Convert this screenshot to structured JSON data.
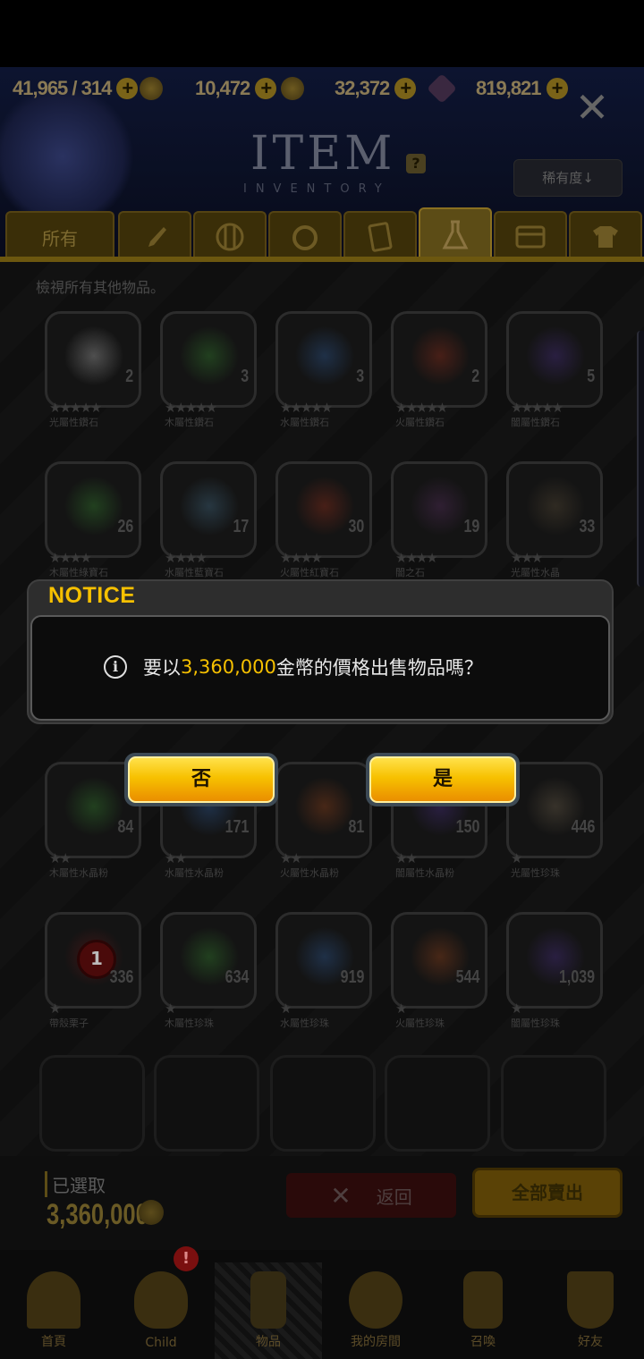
{
  "currencies": [
    {
      "value": "41,965 / 314",
      "icon": "stamina-icon"
    },
    {
      "value": "10,472",
      "icon": "gold-coin-icon"
    },
    {
      "value": "32,372",
      "icon": "coin-stack-icon"
    },
    {
      "value": "819,821",
      "icon": "gem-icon"
    }
  ],
  "header": {
    "title": "ITEM",
    "subtitle": "INVENTORY",
    "help": "?",
    "sort_label": "稀有度↓",
    "close": "✕"
  },
  "tabs": [
    {
      "label": "所有",
      "icon": ""
    },
    {
      "label": "",
      "icon": "sword-icon"
    },
    {
      "label": "",
      "icon": "shield-icon"
    },
    {
      "label": "",
      "icon": "ring-icon"
    },
    {
      "label": "",
      "icon": "card-icon"
    },
    {
      "label": "",
      "icon": "potion-flask-icon"
    },
    {
      "label": "",
      "icon": "chest-icon"
    },
    {
      "label": "",
      "icon": "armor-shirt-icon"
    }
  ],
  "hint": "檢視所有其他物品。",
  "items": [
    {
      "name": "光屬性鑽石",
      "qty": "2",
      "stars": "★★★★★",
      "color": "#8a8a8a"
    },
    {
      "name": "木屬性鑽石",
      "qty": "3",
      "stars": "★★★★★",
      "color": "#2f6b2a"
    },
    {
      "name": "水屬性鑽石",
      "qty": "3",
      "stars": "★★★★★",
      "color": "#2a4c7a"
    },
    {
      "name": "火屬性鑽石",
      "qty": "2",
      "stars": "★★★★★",
      "color": "#7a2a1a"
    },
    {
      "name": "闇屬性鑽石",
      "qty": "5",
      "stars": "★★★★★",
      "color": "#3f2a6e"
    },
    {
      "name": "木屬性綠寶石",
      "qty": "26",
      "stars": "★★★★",
      "color": "#2f6b2a"
    },
    {
      "name": "水屬性藍寶石",
      "qty": "17",
      "stars": "★★★★",
      "color": "#3a5a6e"
    },
    {
      "name": "火屬性紅寶石",
      "qty": "30",
      "stars": "★★★★",
      "color": "#7a2a1a"
    },
    {
      "name": "闇之石",
      "qty": "19",
      "stars": "★★★★",
      "color": "#4a2a50"
    },
    {
      "name": "光屬性水晶",
      "qty": "33",
      "stars": "★★★",
      "color": "#4a4030"
    },
    {
      "name": "木屬性水晶粉",
      "qty": "84",
      "stars": "★★",
      "color": "#2f6b2a"
    },
    {
      "name": "水屬性水晶粉",
      "qty": "171",
      "stars": "★★",
      "color": "#2a4c7a"
    },
    {
      "name": "火屬性水晶粉",
      "qty": "81",
      "stars": "★★",
      "color": "#7a3a1a"
    },
    {
      "name": "闇屬性水晶粉",
      "qty": "150",
      "stars": "★★",
      "color": "#3f2a6e"
    },
    {
      "name": "光屬性珍珠",
      "qty": "446",
      "stars": "★",
      "color": "#5a5040"
    },
    {
      "name": "帶殼栗子",
      "qty": "336",
      "stars": "★",
      "color": "#6a1a1a",
      "badge": "1"
    },
    {
      "name": "木屬性珍珠",
      "qty": "634",
      "stars": "★",
      "color": "#2f6b2a"
    },
    {
      "name": "水屬性珍珠",
      "qty": "919",
      "stars": "★",
      "color": "#2a4c7a"
    },
    {
      "name": "火屬性珍珠",
      "qty": "544",
      "stars": "★",
      "color": "#7a3a1a"
    },
    {
      "name": "闇屬性珍珠",
      "qty": "1,039",
      "stars": "★",
      "color": "#3f2a6e"
    }
  ],
  "footer": {
    "selected_label": "已選取",
    "selected_value": "3,360,000",
    "back_label": "返回",
    "sell_all_label": "全部賣出"
  },
  "nav": [
    {
      "label": "首頁",
      "icon": "home-icon"
    },
    {
      "label": "Child",
      "icon": "child-flame-icon",
      "badge": "!"
    },
    {
      "label": "物品",
      "icon": "knight-icon"
    },
    {
      "label": "我的房間",
      "icon": "crown-icon"
    },
    {
      "label": "召喚",
      "icon": "summon-bottle-icon"
    },
    {
      "label": "好友",
      "icon": "friends-shield-icon"
    }
  ],
  "dialog": {
    "title": "NOTICE",
    "message_prefix": "要以",
    "message_amount": "3,360,000",
    "message_suffix": "金幣的價格出售物品嗎？",
    "info": "i",
    "no_label": "否",
    "yes_label": "是"
  },
  "colors": {
    "accent": "#f6c000",
    "button_gradient_top": "#ffe14a",
    "button_gradient_bottom": "#ea8e00"
  }
}
